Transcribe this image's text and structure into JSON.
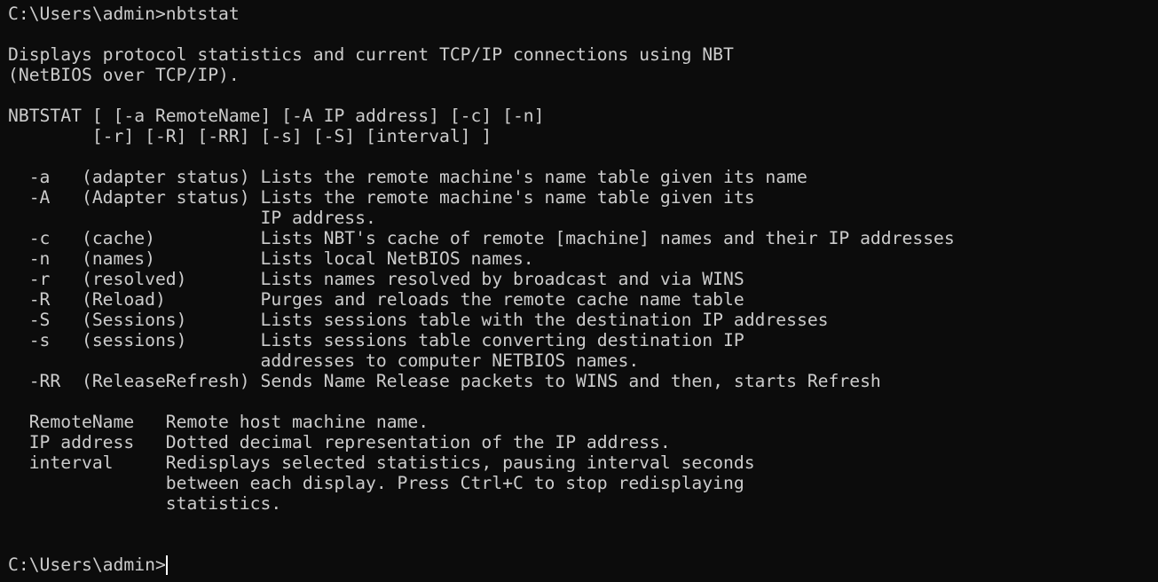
{
  "terminal": {
    "lines": [
      "C:\\Users\\admin>nbtstat",
      "",
      "Displays protocol statistics and current TCP/IP connections using NBT",
      "(NetBIOS over TCP/IP).",
      "",
      "NBTSTAT [ [-a RemoteName] [-A IP address] [-c] [-n]",
      "        [-r] [-R] [-RR] [-s] [-S] [interval] ]",
      "",
      "  -a   (adapter status) Lists the remote machine's name table given its name",
      "  -A   (Adapter status) Lists the remote machine's name table given its",
      "                        IP address.",
      "  -c   (cache)          Lists NBT's cache of remote [machine] names and their IP addresses",
      "  -n   (names)          Lists local NetBIOS names.",
      "  -r   (resolved)       Lists names resolved by broadcast and via WINS",
      "  -R   (Reload)         Purges and reloads the remote cache name table",
      "  -S   (Sessions)       Lists sessions table with the destination IP addresses",
      "  -s   (sessions)       Lists sessions table converting destination IP",
      "                        addresses to computer NETBIOS names.",
      "  -RR  (ReleaseRefresh) Sends Name Release packets to WINS and then, starts Refresh",
      "",
      "  RemoteName   Remote host machine name.",
      "  IP address   Dotted decimal representation of the IP address.",
      "  interval     Redisplays selected statistics, pausing interval seconds",
      "               between each display. Press Ctrl+C to stop redisplaying",
      "               statistics.",
      "",
      "",
      "C:\\Users\\admin>"
    ]
  }
}
